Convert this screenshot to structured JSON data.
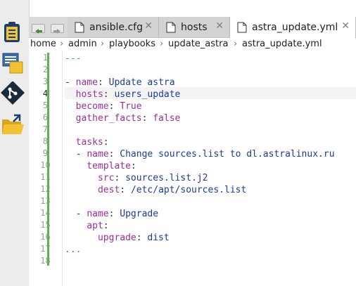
{
  "sidebar": {
    "buttons": [
      {
        "name": "project-panel-button",
        "icon": "clipboard-icon"
      },
      {
        "name": "documents-panel-button",
        "icon": "documents-icon"
      },
      {
        "name": "git-panel-button",
        "icon": "git-icon"
      },
      {
        "name": "filesystem-panel-button",
        "icon": "folder-icon"
      }
    ]
  },
  "tabs": [
    {
      "label": "ansible.cfg",
      "close": "✕",
      "active": false
    },
    {
      "label": "hosts",
      "close": "✕",
      "active": false
    },
    {
      "label": "astra_update.yml",
      "close": "✕",
      "active": true
    }
  ],
  "breadcrumb": [
    "home",
    "admin",
    "playbooks",
    "update_astra",
    "astra_update.yml"
  ],
  "breadcrumb_separator": "›",
  "editor": {
    "current_line": 4,
    "line_numbers": [
      "1",
      "2",
      "3",
      "4",
      "5",
      "6",
      "7",
      "8",
      "9",
      "10",
      "11",
      "12",
      "13",
      "14",
      "15",
      "16",
      "17",
      "18"
    ],
    "lines": [
      [
        {
          "t": "---",
          "c": "doc"
        }
      ],
      [],
      [
        {
          "t": "- ",
          "c": "dash"
        },
        {
          "t": "name",
          "c": "key"
        },
        {
          "t": ": ",
          "c": "punc"
        },
        {
          "t": "Update astra",
          "c": "val"
        }
      ],
      [
        {
          "t": "  hosts",
          "c": "key"
        },
        {
          "t": ": ",
          "c": "punc"
        },
        {
          "t": "users_update",
          "c": "val"
        }
      ],
      [
        {
          "t": "  become",
          "c": "key"
        },
        {
          "t": ": ",
          "c": "punc"
        },
        {
          "t": "True",
          "c": "key"
        }
      ],
      [
        {
          "t": "  gather_facts",
          "c": "key"
        },
        {
          "t": ": ",
          "c": "punc"
        },
        {
          "t": "false",
          "c": "key"
        }
      ],
      [],
      [
        {
          "t": "  tasks",
          "c": "key"
        },
        {
          "t": ":",
          "c": "punc"
        }
      ],
      [
        {
          "t": "  - ",
          "c": "dash"
        },
        {
          "t": "name",
          "c": "key"
        },
        {
          "t": ": ",
          "c": "punc"
        },
        {
          "t": "Change sources.list to dl.astralinux.ru",
          "c": "val"
        }
      ],
      [
        {
          "t": "    template",
          "c": "key"
        },
        {
          "t": ":",
          "c": "punc"
        }
      ],
      [
        {
          "t": "      src",
          "c": "key"
        },
        {
          "t": ": ",
          "c": "punc"
        },
        {
          "t": "sources.list.j2",
          "c": "val"
        }
      ],
      [
        {
          "t": "      dest",
          "c": "key"
        },
        {
          "t": ": ",
          "c": "punc"
        },
        {
          "t": "/etc/apt/sources.list",
          "c": "val"
        }
      ],
      [],
      [
        {
          "t": "  - ",
          "c": "dash"
        },
        {
          "t": "name",
          "c": "key"
        },
        {
          "t": ": ",
          "c": "punc"
        },
        {
          "t": "Upgrade",
          "c": "val"
        }
      ],
      [
        {
          "t": "    apt",
          "c": "key"
        },
        {
          "t": ":",
          "c": "punc"
        }
      ],
      [
        {
          "t": "      upgrade",
          "c": "key"
        },
        {
          "t": ": ",
          "c": "punc"
        },
        {
          "t": "dist",
          "c": "val"
        }
      ],
      [
        {
          "t": "...",
          "c": "doc"
        }
      ],
      []
    ]
  }
}
